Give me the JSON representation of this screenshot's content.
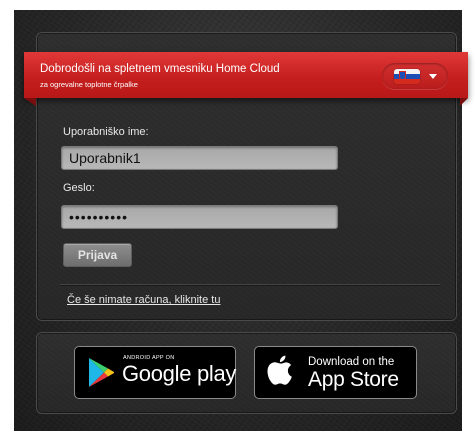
{
  "header": {
    "title": "Dobrodošli na spletnem vmesniku Home Cloud",
    "subtitle": "za ogrevalne toplotne črpalke",
    "language": {
      "icon": "slovenia-flag-icon",
      "dropdown_icon": "chevron-down-icon"
    }
  },
  "login": {
    "username_label": "Uporabniško ime:",
    "username_value": "Uporabnik1",
    "password_label": "Geslo:",
    "password_value": "••••••••••",
    "submit_label": "Prijava",
    "register_link": "Če še nimate računa, kliknite tu"
  },
  "stores": {
    "google_play": {
      "small": "ANDROID APP ON",
      "big": "Google play",
      "icon": "google-play-icon"
    },
    "app_store": {
      "small": "Download on the",
      "big": "App Store",
      "icon": "apple-icon"
    }
  },
  "colors": {
    "ribbon": "#c61f1f",
    "background": "#2a2a2a",
    "field": "#b0b0b0",
    "button": "#7d7d7d"
  }
}
